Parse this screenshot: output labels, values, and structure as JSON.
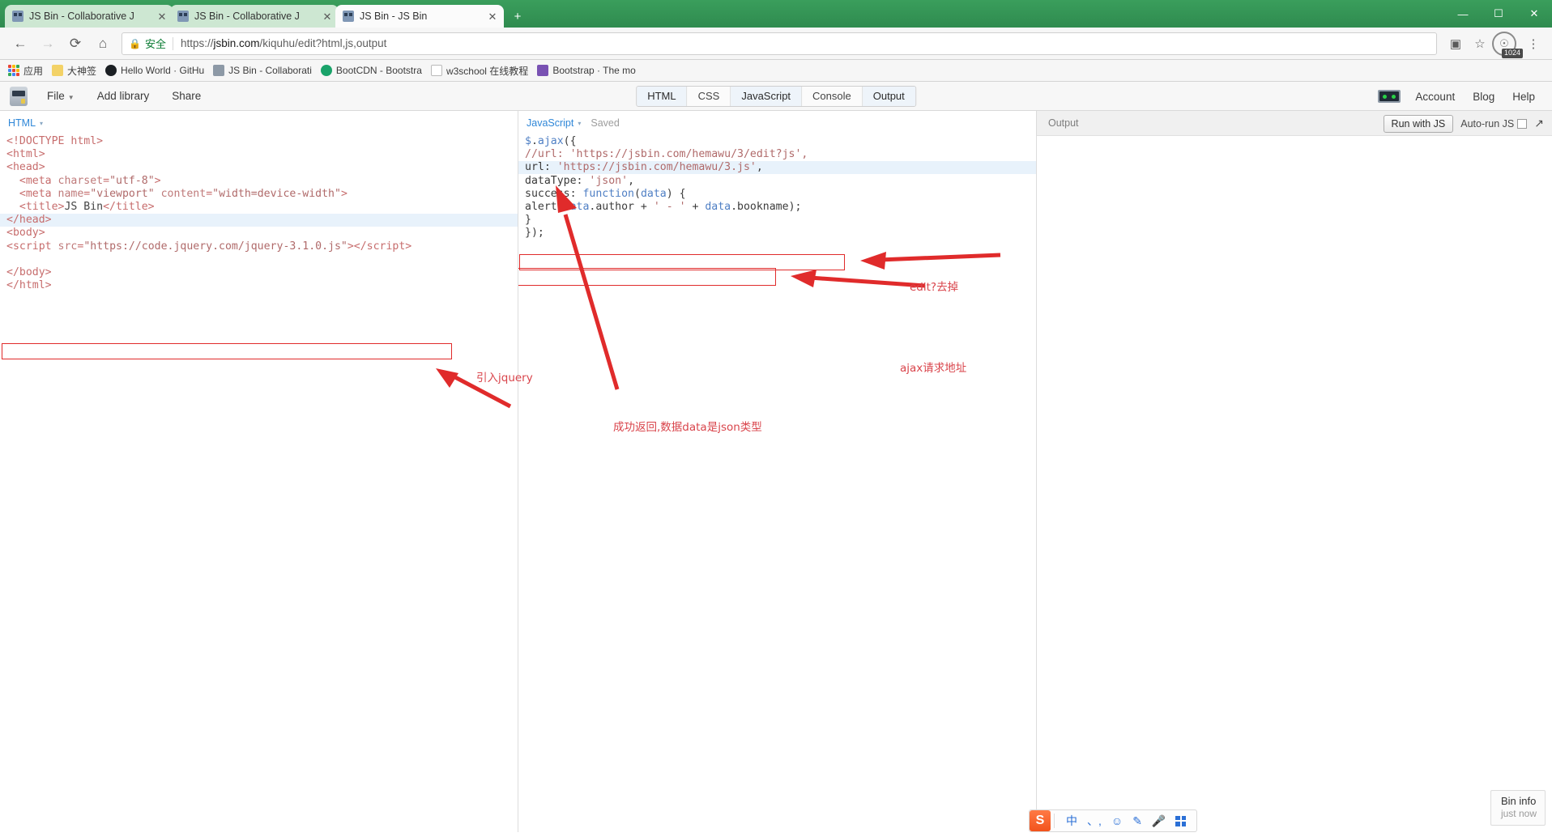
{
  "browser": {
    "tabs": [
      {
        "title": "JS Bin - Collaborative J",
        "icon": "jsbin-favicon",
        "active": false
      },
      {
        "title": "JS Bin - Collaborative J",
        "icon": "jsbin-favicon",
        "active": false
      },
      {
        "title": "JS Bin - JS Bin",
        "icon": "jsbin-favicon",
        "active": true
      }
    ],
    "new_tab_label": "+",
    "window_controls": {
      "minimize": "—",
      "maximize": "☐",
      "close": "✕"
    },
    "nav": {
      "back": "←",
      "forward": "→",
      "reload": "⟳",
      "home": "⌂"
    },
    "omnibox": {
      "lock_icon": "lock-icon",
      "secure_label": "安全",
      "url_scheme": "https://",
      "url_host": "jsbin.com",
      "url_path": "/kiquhu/edit?html,js,output",
      "full_url": "https://jsbin.com/kiquhu/edit?html,js,output"
    },
    "toolbar_icons": {
      "translate": "translate-icon",
      "star": "star-icon",
      "profile": "profile-icon",
      "menu": "kebab-menu-icon"
    },
    "zoom_badge": "1024",
    "bookmarks": [
      {
        "label": "应用",
        "icon": "apps-grid-icon",
        "color": ""
      },
      {
        "label": "大神签",
        "icon": "folder-icon",
        "color": "#f3d267"
      },
      {
        "label": "Hello World · GitHu",
        "icon": "github-icon",
        "color": "#1b1f23"
      },
      {
        "label": "JS Bin - Collaborati",
        "icon": "jsbin-favicon",
        "color": "#8d99a6"
      },
      {
        "label": "BootCDN - Bootstra",
        "icon": "bootcdn-icon",
        "color": "#1aa36a"
      },
      {
        "label": "w3school 在线教程",
        "icon": "page-icon",
        "color": "#ffffff"
      },
      {
        "label": "Bootstrap · The mo",
        "icon": "bootstrap-icon",
        "color": "#7952b3"
      }
    ]
  },
  "jsbin": {
    "logo": "jsbin-logo",
    "menus": [
      {
        "label": "File",
        "has_caret": true
      },
      {
        "label": "Add library",
        "has_caret": false
      },
      {
        "label": "Share",
        "has_caret": false
      }
    ],
    "panel_tabs": [
      {
        "label": "HTML",
        "active": true
      },
      {
        "label": "CSS",
        "active": false
      },
      {
        "label": "JavaScript",
        "active": true
      },
      {
        "label": "Console",
        "active": false
      },
      {
        "label": "Output",
        "active": true
      }
    ],
    "header_links": [
      {
        "label": "Account"
      },
      {
        "label": "Blog"
      },
      {
        "label": "Help"
      }
    ],
    "account_icon": "jsbin-robot-icon"
  },
  "panels": {
    "html": {
      "label": "HTML",
      "caret": "▾",
      "lines": [
        "<!DOCTYPE html>",
        "<html>",
        "<head>",
        "  <meta charset=\"utf-8\">",
        "  <meta name=\"viewport\" content=\"width=device-width\">",
        "  <title>JS Bin</title>",
        "</head>",
        "<body>",
        "<script src=\"https://code.jquery.com/jquery-3.1.0.js\"></script>",
        "",
        "</body>",
        "</html>"
      ],
      "highlighted_line_index": 6
    },
    "javascript": {
      "label": "JavaScript",
      "caret": "▾",
      "status": "Saved",
      "lines": [
        "$.ajax({",
        "//url: 'https://jsbin.com/hemawu/3/edit?js',",
        "url: 'https://jsbin.com/hemawu/3.js',",
        "dataType: 'json',",
        "success: function(data) {",
        "alert(data.author + ' - ' + data.bookname);",
        "}",
        "});"
      ],
      "highlighted_line_index": 2
    },
    "output": {
      "label": "Output",
      "run_button": "Run with JS",
      "autorun_label": "Auto-run JS",
      "autorun_checked": false,
      "expand_icon": "expand-arrow-icon"
    }
  },
  "annotations": [
    {
      "id": "annot-jquery",
      "text": "引入jquery"
    },
    {
      "id": "annot-edit-remove",
      "text": "edit?去掉"
    },
    {
      "id": "annot-ajax-url",
      "text": "ajax请求地址"
    },
    {
      "id": "annot-success",
      "text": "成功返回,数据data是json类型"
    }
  ],
  "bin_info": {
    "title": "Bin info",
    "subtitle": "just now"
  },
  "ime": {
    "logo": "sogou-icon",
    "items": [
      "中",
      "、,",
      "☺",
      "✎",
      "🎤",
      "grid"
    ]
  },
  "colors": {
    "chrome_green": "#2f8b4f",
    "annotation_red": "#d9444b",
    "redbox_border": "#e02b2b",
    "link_blue": "#2f87d8",
    "highlight_blue": "#e8f2fb"
  }
}
